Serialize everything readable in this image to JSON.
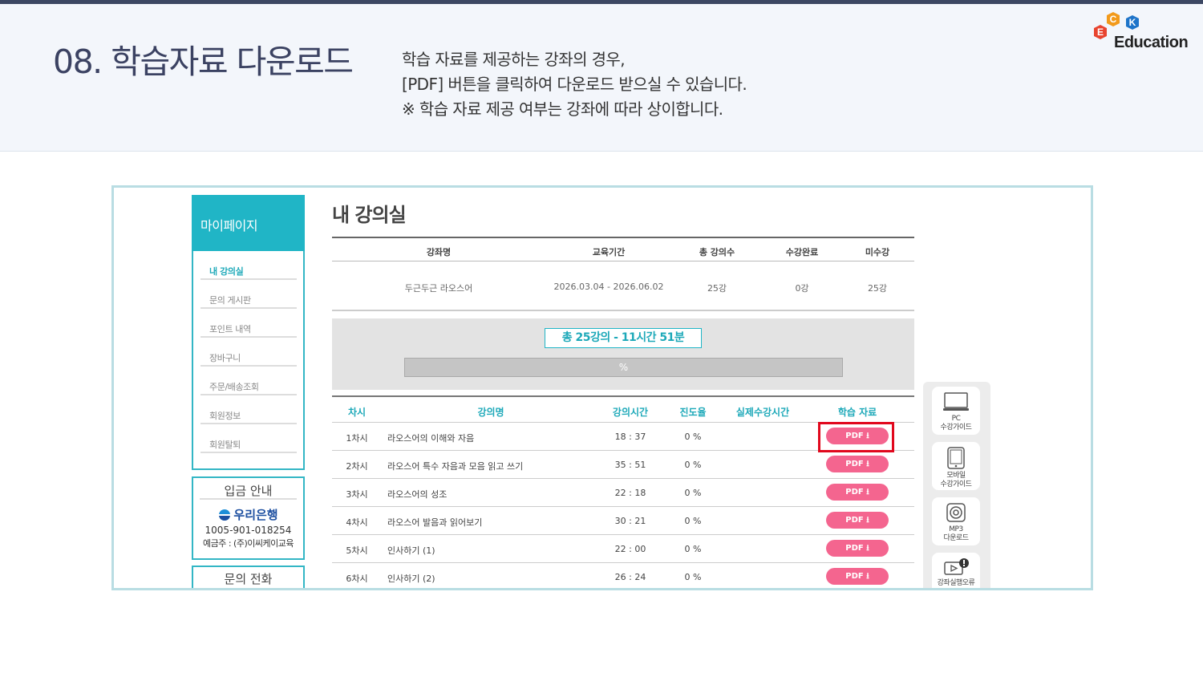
{
  "slide": {
    "title": "08. 학습자료 다운로드",
    "description": [
      "학습 자료를 제공하는 강좌의 경우,",
      "[PDF] 버튼을 클릭하여 다운로드 받으실 수 있습니다.",
      "※ 학습 자료 제공 여부는 강좌에 따라 상이합니다."
    ],
    "logo": {
      "letters": [
        "E",
        "C",
        "K"
      ],
      "text": "Education"
    }
  },
  "sidebar": {
    "header": "마이페이지",
    "items": [
      {
        "label": "내 강의실",
        "active": true
      },
      {
        "label": "문의 게시판",
        "active": false
      },
      {
        "label": "포인트 내역",
        "active": false
      },
      {
        "label": "장바구니",
        "active": false
      },
      {
        "label": "주문/배송조회",
        "active": false
      },
      {
        "label": "회원정보",
        "active": false
      },
      {
        "label": "회원탈퇴",
        "active": false
      }
    ],
    "bank": {
      "title": "입금 안내",
      "name": "우리은행",
      "account": "1005-901-018254",
      "owner": "예금주 : (주)이씨케이교육"
    },
    "phone": {
      "title": "문의 전화"
    }
  },
  "main": {
    "title": "내 강의실",
    "course_table": {
      "headers": [
        "강좌명",
        "교육기간",
        "총 강의수",
        "수강완료",
        "미수강"
      ],
      "row": [
        "두근두근 라오스어",
        "2026.03.04 - 2026.06.02",
        "25강",
        "0강",
        "25강"
      ]
    },
    "progress": {
      "label": "총 25강의 - 11시간 51분",
      "percent_text": "%",
      "percent": 0
    },
    "lecture_table": {
      "headers": [
        "차시",
        "강의명",
        "강의시간",
        "진도율",
        "실제수강시간",
        "학습 자료"
      ],
      "rows": [
        {
          "no": "1차시",
          "name": "라오스어의 이해와 자음",
          "time": "18 : 37",
          "progress": "0 %",
          "actual": "",
          "pdf": "PDF ⭳"
        },
        {
          "no": "2차시",
          "name": "라오스어 특수 자음과 모음 읽고 쓰기",
          "time": "35 : 51",
          "progress": "0 %",
          "actual": "",
          "pdf": "PDF ⭳"
        },
        {
          "no": "3차시",
          "name": "라오스어의 성조",
          "time": "22 : 18",
          "progress": "0 %",
          "actual": "",
          "pdf": "PDF ⭳"
        },
        {
          "no": "4차시",
          "name": "라오스어 발음과 읽어보기",
          "time": "30 : 21",
          "progress": "0 %",
          "actual": "",
          "pdf": "PDF ⭳"
        },
        {
          "no": "5차시",
          "name": "인사하기 (1)",
          "time": "22 : 00",
          "progress": "0 %",
          "actual": "",
          "pdf": "PDF ⭳"
        },
        {
          "no": "6차시",
          "name": "인사하기 (2)",
          "time": "26 : 24",
          "progress": "0 %",
          "actual": "",
          "pdf": "PDF ⭳"
        }
      ]
    }
  },
  "quick_menu": [
    {
      "icon": "monitor-icon",
      "line1": "PC",
      "line2": "수강가이드"
    },
    {
      "icon": "tablet-icon",
      "line1": "모바일",
      "line2": "수강가이드"
    },
    {
      "icon": "speaker-icon",
      "line1": "MP3",
      "line2": "다운로드"
    },
    {
      "icon": "video-alert-icon",
      "line1": "강좌실행오류",
      "line2": ""
    }
  ],
  "colors": {
    "accent": "#20b5c6",
    "pdf_button": "#f4658f",
    "highlight": "#e1081d",
    "title": "#3b4262"
  }
}
